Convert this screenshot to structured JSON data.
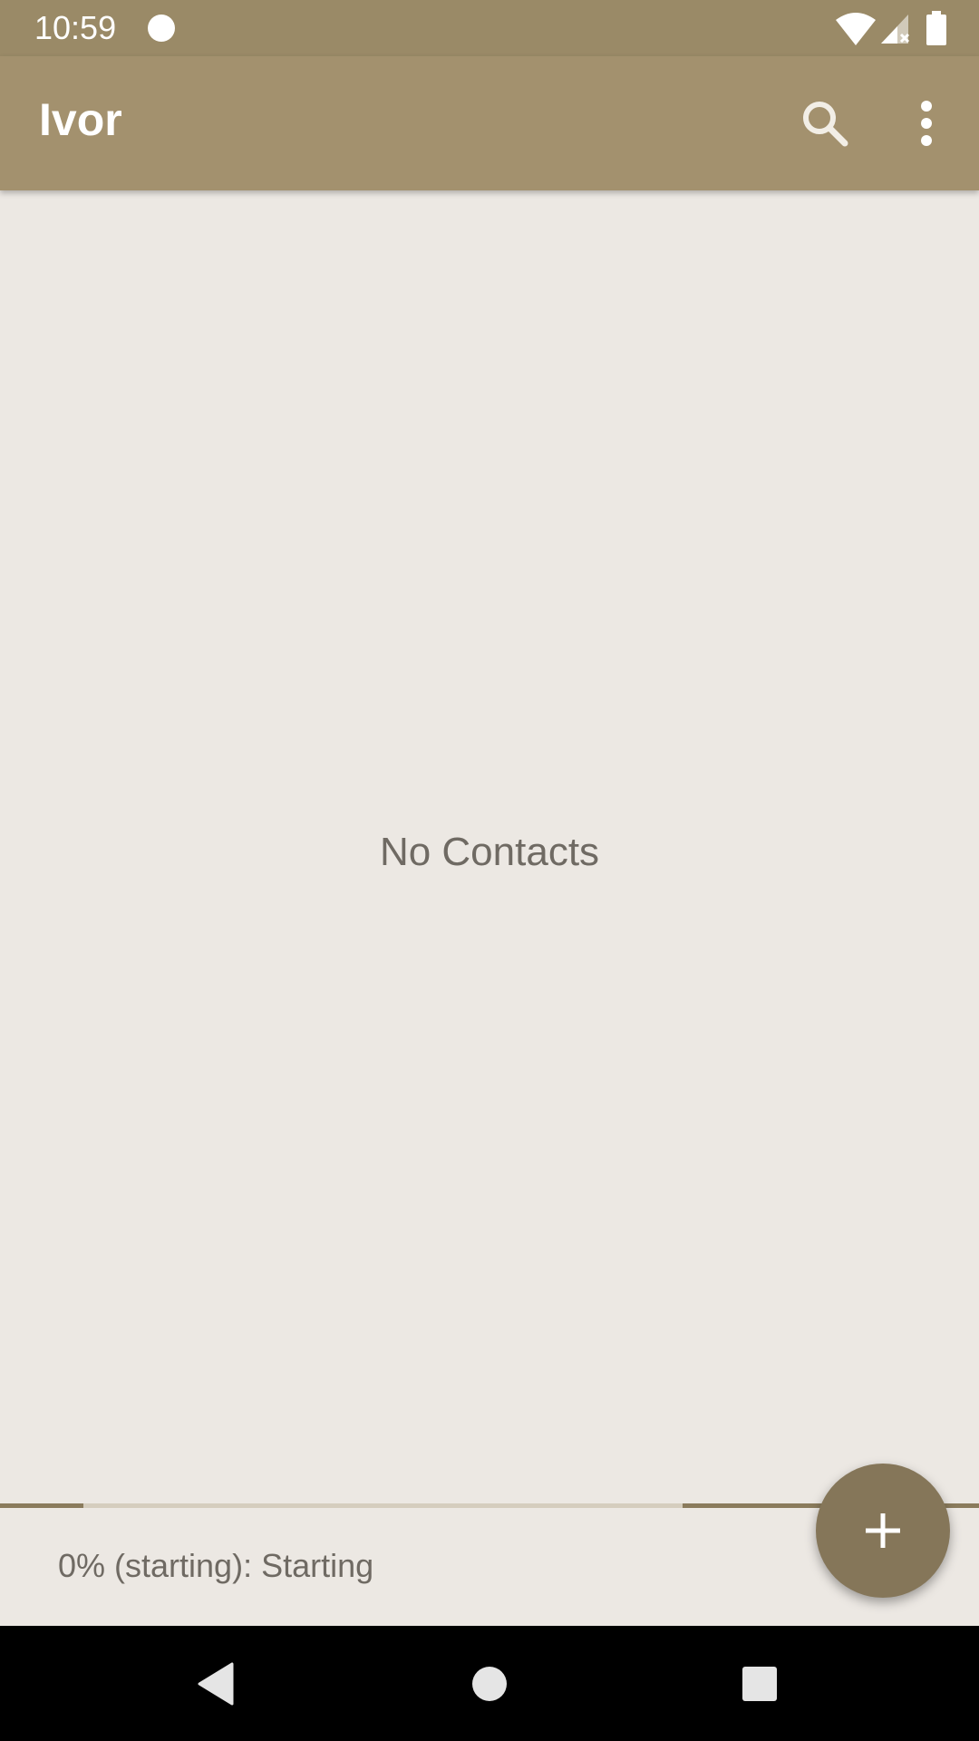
{
  "status_bar": {
    "time": "10:59",
    "icons": [
      "notification-dot-icon",
      "wifi-icon",
      "cell-signal-icon",
      "battery-icon"
    ]
  },
  "app_bar": {
    "title": "Ivor",
    "actions": [
      "search-icon",
      "more-vert-icon"
    ]
  },
  "main": {
    "empty_message": "No Contacts"
  },
  "progress": {
    "percent": 0,
    "status_text": "0% (starting): Starting"
  },
  "fab": {
    "icon": "add-icon"
  },
  "nav_bar": {
    "buttons": [
      "back-icon",
      "home-icon",
      "recents-icon"
    ]
  },
  "colors": {
    "status_bar": "#9A8A67",
    "app_bar": "#A3916E",
    "background": "#ECE8E3",
    "fab": "#857659",
    "progress": "#8A7B5C"
  }
}
